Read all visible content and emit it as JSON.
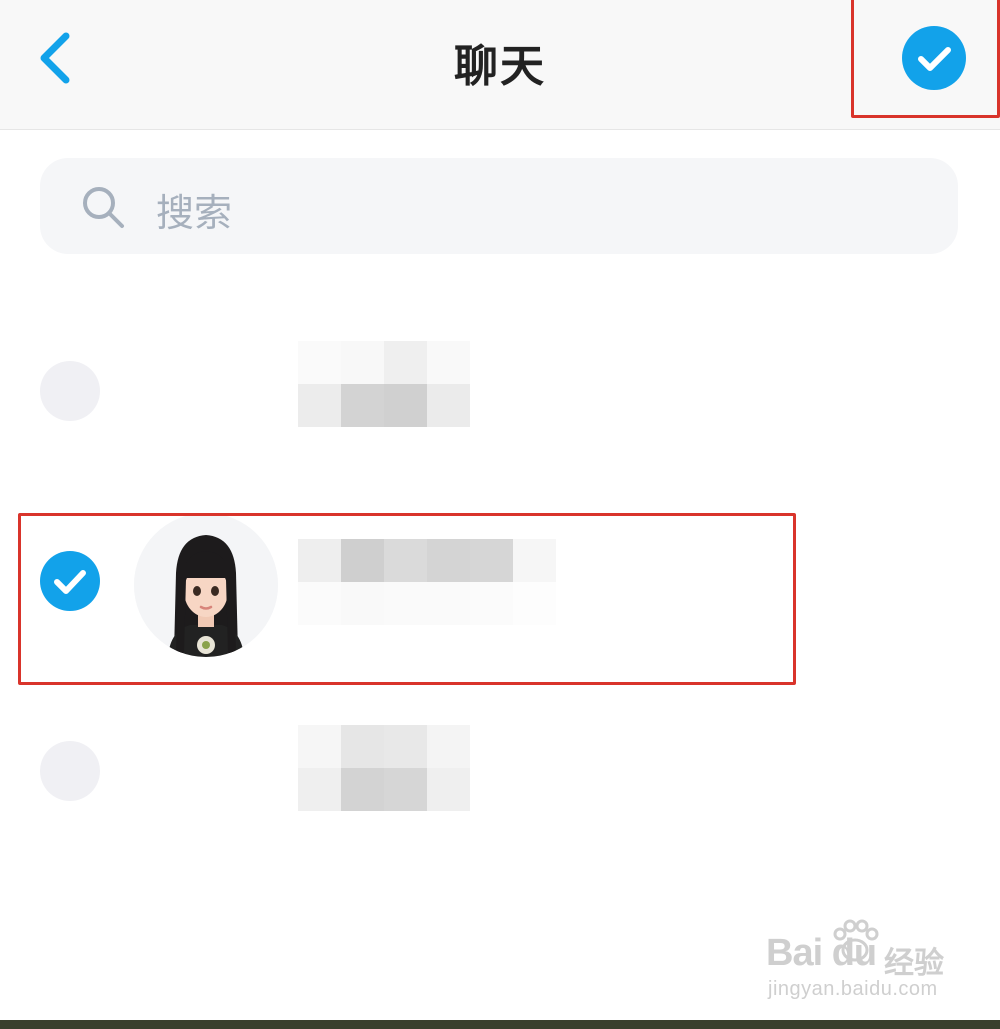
{
  "header": {
    "title": "聊天",
    "back_icon": "chevron-left-icon",
    "confirm_icon": "check-circle-icon"
  },
  "search": {
    "placeholder": "搜索",
    "icon": "search-icon"
  },
  "chats": [
    {
      "selected": false,
      "name": ""
    },
    {
      "selected": true,
      "name": ""
    },
    {
      "selected": false,
      "name": ""
    }
  ],
  "watermark": {
    "logo": "Bai du",
    "brand_cn": "经验",
    "url": "jingyan.baidu.com"
  },
  "colors": {
    "accent": "#12a2ea",
    "title": "#222222",
    "placeholder": "#a6b0bd",
    "annotation": "#d9342b"
  }
}
